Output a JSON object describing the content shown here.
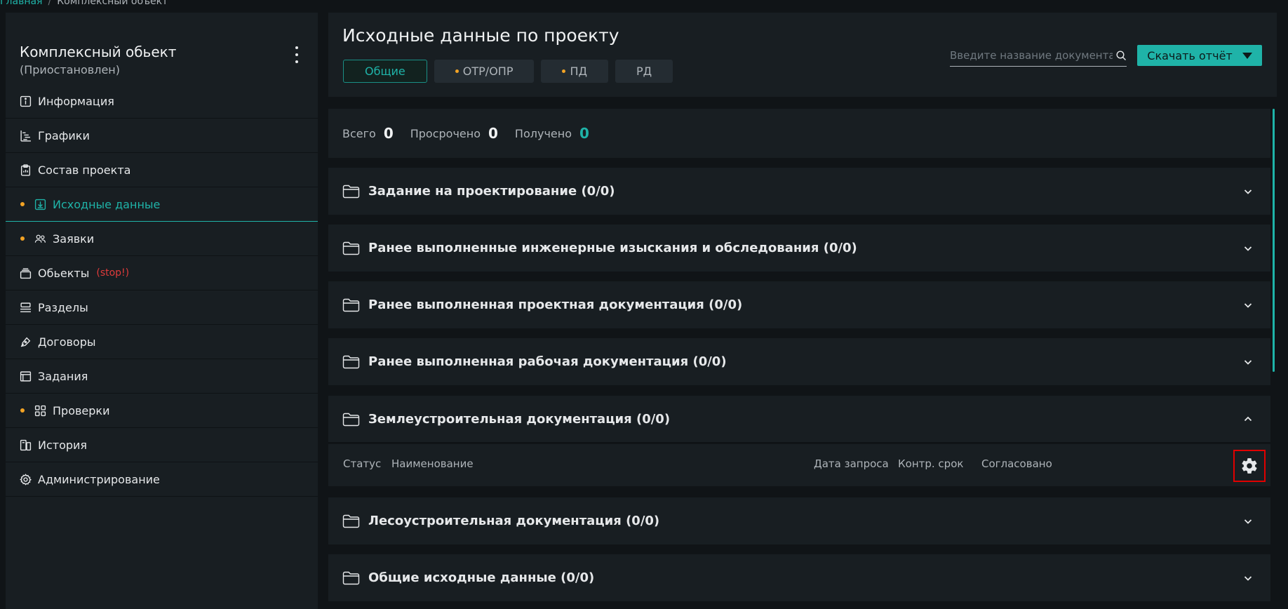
{
  "breadcrumb": {
    "home": "Главная",
    "current": "Комплексный объект"
  },
  "sidebar": {
    "title": "Комплексный обьект",
    "subtitle": "(Приостановлен)",
    "items": [
      {
        "label": "Информация",
        "icon": "info-icon"
      },
      {
        "label": "Графики",
        "icon": "chart-icon"
      },
      {
        "label": "Состав проекта",
        "icon": "clipboard-icon"
      },
      {
        "label": "Исходные данные",
        "icon": "download-icon",
        "active": true,
        "dot": true
      },
      {
        "label": "Заявки",
        "icon": "users-icon",
        "dot": true
      },
      {
        "label": "Обьекты",
        "icon": "stack-icon",
        "badge": "(stop!)"
      },
      {
        "label": "Разделы",
        "icon": "sections-icon"
      },
      {
        "label": "Договоры",
        "icon": "pen-icon"
      },
      {
        "label": "Задания",
        "icon": "tasks-icon"
      },
      {
        "label": "Проверки",
        "icon": "grid-icon",
        "dot": true
      },
      {
        "label": "История",
        "icon": "history-icon"
      },
      {
        "label": "Администрирование",
        "icon": "gear-icon"
      }
    ]
  },
  "header": {
    "title": "Исходные данные по проекту",
    "tabs": [
      {
        "label": "Общие",
        "active": true
      },
      {
        "label": "ОТР/ОПР",
        "dot": true
      },
      {
        "label": "ПД",
        "dot": true
      },
      {
        "label": "РД"
      }
    ],
    "search_placeholder": "Введите название документа",
    "download_label": "Скачать отчёт"
  },
  "stats": {
    "total_label": "Всего",
    "total_value": "0",
    "overdue_label": "Просрочено",
    "overdue_value": "0",
    "received_label": "Получено",
    "received_value": "0"
  },
  "sections": [
    "Задание на проектирование (0/0)",
    "Ранее выполненные инженерные изыскания и обследования (0/0)",
    "Ранее выполненная проектная документация (0/0)",
    "Ранее выполненная рабочая документация (0/0)",
    "Землеустроительная документация (0/0)",
    "Лесоустроительная документация (0/0)",
    "Общие исходные данные (0/0)"
  ],
  "table_columns": {
    "status": "Статус",
    "name": "Наименование",
    "request_date": "Дата запроса",
    "deadline": "Контр. срок",
    "agreed": "Согласовано"
  },
  "colors": {
    "accent": "#1fb3a8",
    "dot": "#f2a324",
    "stop": "#e03b3b",
    "highlight": "#e00000"
  }
}
